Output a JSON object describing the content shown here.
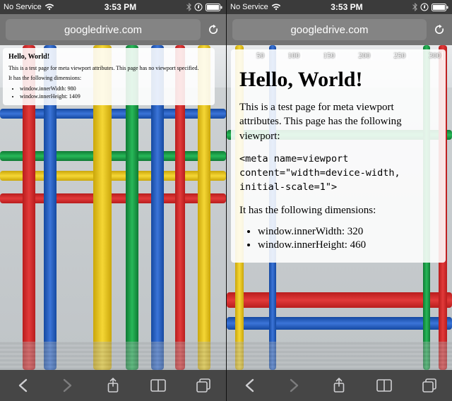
{
  "status": {
    "carrier": "No Service",
    "time": "3:53 PM"
  },
  "address": {
    "url": "googledrive.com"
  },
  "left_page": {
    "heading": "Hello, World!",
    "intro": "This is a test page for meta viewport attributes. This page has no viewport specified.",
    "dims_label": "It has the following dimensions:",
    "dim1": "window.innerWidth: 980",
    "dim2": "window.innerHeight: 1409"
  },
  "right_page": {
    "ruler": [
      "50",
      "100",
      "150",
      "200",
      "250",
      "300"
    ],
    "heading": "Hello, World!",
    "intro": "This is a test page for meta viewport attributes. This page has the following viewport:",
    "code": "<meta name=viewport\ncontent=\"width=device-width,\ninitial-scale=1\">",
    "dims_label": "It has the following dimensions:",
    "dim1": "window.innerWidth: 320",
    "dim2": "window.innerHeight: 460"
  }
}
